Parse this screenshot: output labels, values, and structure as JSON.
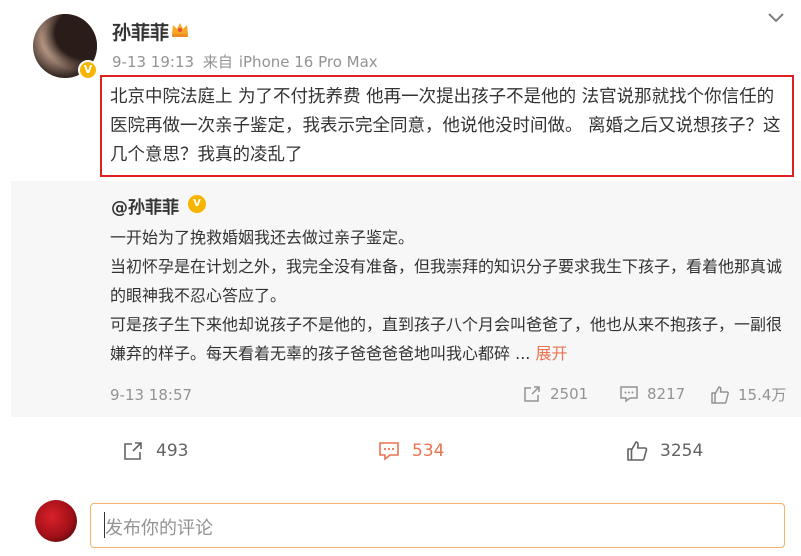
{
  "author": {
    "name": "孙菲菲",
    "verified_mark": "V",
    "time": "9-13 19:13",
    "source_prefix": "来自",
    "source_device": "iPhone 16 Pro Max"
  },
  "post": {
    "text": "北京中院法庭上 为了不付抚养费 他再一次提出孩子不是他的 法官说那就找个你信任的医院再做一次亲子鉴定，我表示完全同意，他说他没时间做。 离婚之后又说想孩子？这几个意思？我真的凌乱了"
  },
  "repost": {
    "user": "@孙菲菲",
    "verified_mark": "V",
    "lines": [
      "一开始为了挽救婚姻我还去做过亲子鉴定。",
      "当初怀孕是在计划之外，我完全没有准备，但我崇拜的知识分子要求我生下孩子，看着他那真诚的眼神我不忍心答应了。",
      "可是孩子生下来他却说孩子不是他的，直到孩子八个月会叫爸爸了，他也从来不抱孩子，一副很嫌弃的样子。每天看着无辜的孩子爸爸爸爸地叫我心都碎"
    ],
    "ellipsis": " ... ",
    "expand_label": "展开",
    "time": "9-13 18:57",
    "reposts": "2501",
    "comments": "8217",
    "likes": "15.4万"
  },
  "actions": {
    "repost_count": "493",
    "comment_count": "534",
    "like_count": "3254"
  },
  "comment_box": {
    "placeholder": "发布你的评论"
  },
  "colors": {
    "highlight_border": "#e02020",
    "accent": "#eb7350",
    "verified": "#f7b500"
  }
}
